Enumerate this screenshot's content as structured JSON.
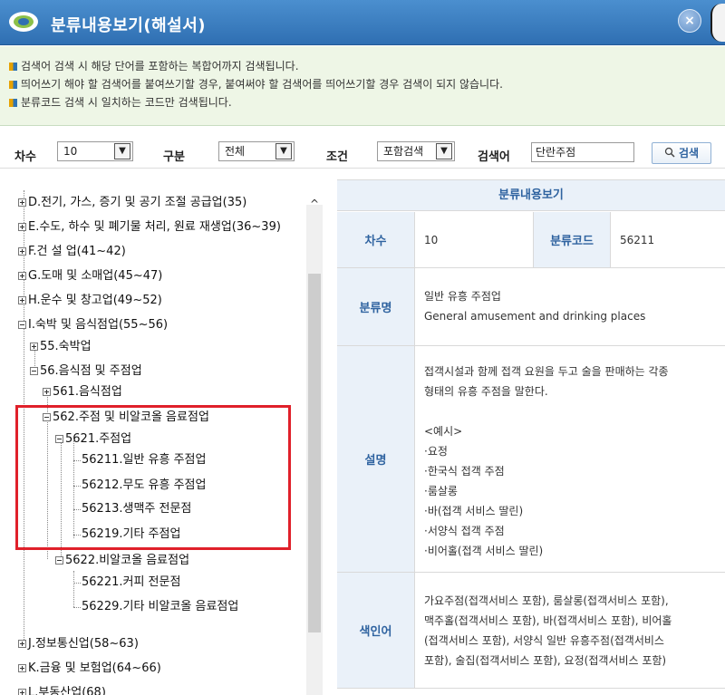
{
  "window": {
    "title": "분류내용보기(해설서)",
    "close_label": "×"
  },
  "notices": [
    "검색어 검색 시 해당 단어를 포함하는 복합어까지 검색됩니다.",
    "띄어쓰기 해야 할 검색어를 붙여쓰기할 경우, 붙여써야 할 검색어를 띄어쓰기할 경우 검색이 되지 않습니다.",
    "분류코드 검색 시 일치하는 코드만 검색됩니다."
  ],
  "search": {
    "edition_label": "차수",
    "edition_value": "10",
    "category_label": "구분",
    "category_value": "전체",
    "condition_label": "조건",
    "condition_value": "포함검색",
    "keyword_label": "검색어",
    "keyword_value": "단란주점",
    "search_button": "검색",
    "dropdown_arrow": "▼"
  },
  "tree": {
    "items": [
      {
        "label": "D.전기, 가스, 증기 및 공기 조절 공급업(35)",
        "toggle": "plus"
      },
      {
        "label": "E.수도, 하수 및 폐기물 처리, 원료 재생업(36~39)",
        "toggle": "plus"
      },
      {
        "label": "F.건 설 업(41~42)",
        "toggle": "plus"
      },
      {
        "label": "G.도매 및 소매업(45~47)",
        "toggle": "plus"
      },
      {
        "label": "H.운수 및 창고업(49~52)",
        "toggle": "plus"
      },
      {
        "label": "I.숙박 및 음식점업(55~56)",
        "toggle": "minus"
      },
      {
        "label": "55.숙박업",
        "toggle": "plus"
      },
      {
        "label": "56.음식점 및 주점업",
        "toggle": "minus"
      },
      {
        "label": "561.음식점업",
        "toggle": "plus"
      },
      {
        "label": "562.주점 및 비알코올 음료점업",
        "toggle": "minus"
      },
      {
        "label": "5621.주점업",
        "toggle": "minus"
      },
      {
        "label": "56211.일반 유흥 주점업",
        "toggle": "none"
      },
      {
        "label": "56212.무도 유흥 주점업",
        "toggle": "none"
      },
      {
        "label": "56213.생맥주 전문점",
        "toggle": "none"
      },
      {
        "label": "56219.기타 주점업",
        "toggle": "none"
      },
      {
        "label": "5622.비알코올 음료점업",
        "toggle": "minus"
      },
      {
        "label": "56221.커피 전문점",
        "toggle": "none"
      },
      {
        "label": "56229.기타 비알코올 음료점업",
        "toggle": "none"
      },
      {
        "label": "J.정보통신업(58~63)",
        "toggle": "plus"
      },
      {
        "label": "K.금융 및 보험업(64~66)",
        "toggle": "plus"
      },
      {
        "label": "L.부동산업(68)",
        "toggle": "plus"
      }
    ],
    "scroll_up": "^"
  },
  "detail": {
    "header": "분류내용보기",
    "edition_label": "차수",
    "edition_value": "10",
    "code_label": "분류코드",
    "code_value": "56211",
    "name_label": "분류명",
    "name_ko": "일반 유흥 주점업",
    "name_en": "General amusement and drinking places",
    "desc_label": "설명",
    "desc_lines": [
      "접객시설과 함께 접객 요원을 두고 술을 판매하는 각종",
      "형태의 유흥 주점을 말한다.",
      "",
      "<예시>",
      "·요정",
      "·한국식 접객 주점",
      "·룸살롱",
      "·바(접객 서비스 딸린)",
      "·서양식 접객 주점",
      "·비어홀(접객 서비스 딸린)"
    ],
    "index_label": "색인어",
    "index_lines": [
      "가요주점(접객서비스 포함), 룸살롱(접객서비스 포함),",
      "맥주홀(접객서비스 포함), 바(접객서비스 포함), 비어홀",
      "(접객서비스 포함), 서양식 일반 유흥주점(접객서비스",
      "포함), 술집(접객서비스 포함), 요정(접객서비스 포함)"
    ]
  },
  "colors": {
    "titlebar": "#3a7fc2",
    "notice_bg": "#eef6e6",
    "highlight_box": "#e0202a",
    "label_text": "#2f63a0"
  }
}
